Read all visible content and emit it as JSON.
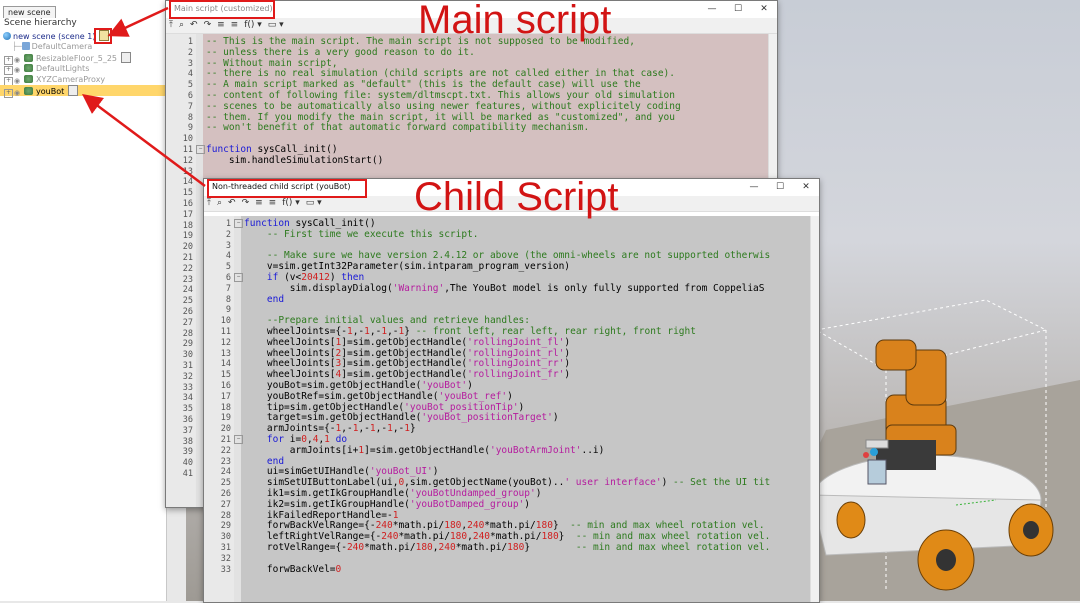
{
  "hierarchy": {
    "tab": "new scene",
    "title": "Scene hierarchy",
    "items": [
      {
        "label": "new scene (scene 1)"
      },
      {
        "label": "DefaultCamera"
      },
      {
        "label": "ResizableFloor_5_25"
      },
      {
        "label": "DefaultLights"
      },
      {
        "label": "XYZCameraProxy"
      },
      {
        "label": "youBot"
      }
    ]
  },
  "main_script": {
    "title": "Main script (customized)",
    "callout": "Main script",
    "toolbar": [
      "⤒",
      "⌕",
      "↶",
      "↷",
      "≡",
      "≡",
      "f() ▾",
      "▭ ▾"
    ],
    "title_buttons": [
      "—",
      "☐",
      "✕"
    ],
    "lines": [
      "-- This is the main script. The main script is not supposed to be modified,",
      "-- unless there is a very good reason to do it.",
      "-- Without main script,",
      "-- there is no real simulation (child scripts are not called either in that case).",
      "-- A main script marked as \"default\" (this is the default case) will use the",
      "-- content of following file: system/dltmscpt.txt. This allows your old simulation",
      "-- scenes to be automatically also using newer features, without explicitely coding",
      "-- them. If you modify the main script, it will be marked as \"customized\", and you",
      "-- won't benefit of that automatic forward compatibility mechanism.",
      "",
      "function sysCall_init()",
      "    sim.handleSimulationStart()"
    ],
    "numbers": [
      "1",
      "2",
      "3",
      "4",
      "5",
      "6",
      "7",
      "8",
      "9",
      "10",
      "11",
      "12",
      "13",
      "14",
      "15",
      "16",
      "17",
      "18",
      "19",
      "20",
      "21",
      "22",
      "23",
      "24",
      "25",
      "26",
      "27",
      "28",
      "29",
      "30",
      "31",
      "32",
      "33",
      "34",
      "35",
      "36",
      "37",
      "38",
      "39",
      "40",
      "41"
    ]
  },
  "child_script": {
    "title": "Non-threaded child script (youBot)",
    "callout": "Child Script",
    "toolbar": [
      "⤒",
      "⌕",
      "↶",
      "↷",
      "≡",
      "≡",
      "f() ▾",
      "▭ ▾"
    ],
    "title_buttons": [
      "—",
      "☐",
      "✕"
    ],
    "lines": [
      "function sysCall_init()",
      "    -- First time we execute this script.",
      "",
      "    -- Make sure we have version 2.4.12 or above (the omni-wheels are not supported otherwis",
      "    v=sim.getInt32Parameter(sim.intparam_program_version)",
      "    if (v<20412) then",
      "        sim.displayDialog('Warning','The YouBot model is only fully supported from CoppeliaS",
      "    end",
      "",
      "    --Prepare initial values and retrieve handles:",
      "    wheelJoints={-1,-1,-1,-1} -- front left, rear left, rear right, front right",
      "    wheelJoints[1]=sim.getObjectHandle('rollingJoint_fl')",
      "    wheelJoints[2]=sim.getObjectHandle('rollingJoint_rl')",
      "    wheelJoints[3]=sim.getObjectHandle('rollingJoint_rr')",
      "    wheelJoints[4]=sim.getObjectHandle('rollingJoint_fr')",
      "    youBot=sim.getObjectHandle('youBot')",
      "    youBotRef=sim.getObjectHandle('youBot_ref')",
      "    tip=sim.getObjectHandle('youBot_positionTip')",
      "    target=sim.getObjectHandle('youBot_positionTarget')",
      "    armJoints={-1,-1,-1,-1,-1}",
      "    for i=0,4,1 do",
      "        armJoints[i+1]=sim.getObjectHandle('youBotArmJoint'..i)",
      "    end",
      "    ui=simGetUIHandle('youBot_UI')",
      "    simSetUIButtonLabel(ui,0,sim.getObjectName(youBot)..' user interface') -- Set the UI tit",
      "    ik1=sim.getIkGroupHandle('youBotUndamped_group')",
      "    ik2=sim.getIkGroupHandle('youBotDamped_group')",
      "    ikFailedReportHandle=-1",
      "    forwBackVelRange={-240*math.pi/180,240*math.pi/180}  -- min and max wheel rotation vel.",
      "    leftRightVelRange={-240*math.pi/180,240*math.pi/180}  -- min and max wheel rotation vel.",
      "    rotVelRange={-240*math.pi/180,240*math.pi/180}        -- min and max wheel rotation vel.",
      "",
      "    forwBackVel=0"
    ],
    "numbers": [
      "1",
      "2",
      "3",
      "4",
      "5",
      "6",
      "7",
      "8",
      "9",
      "10",
      "11",
      "12",
      "13",
      "14",
      "15",
      "16",
      "17",
      "18",
      "19",
      "20",
      "21",
      "22",
      "23",
      "24",
      "25",
      "26",
      "27",
      "28",
      "29",
      "30",
      "31",
      "32",
      "33"
    ]
  },
  "colors": {
    "main_bg": "#d4c0c0",
    "child_bg": "#c6c6c6",
    "annotation_red": "#e01a1a",
    "comment": "#2d7a1e",
    "keyword": "#1a1ad6",
    "string": "#b51c9e",
    "number": "#d01f1f",
    "selection": "#ffd66b"
  },
  "icons": {
    "scene": "scene-icon",
    "camera": "camera-icon",
    "shape": "shape-icon",
    "light": "light-icon",
    "script": "script-icon"
  }
}
